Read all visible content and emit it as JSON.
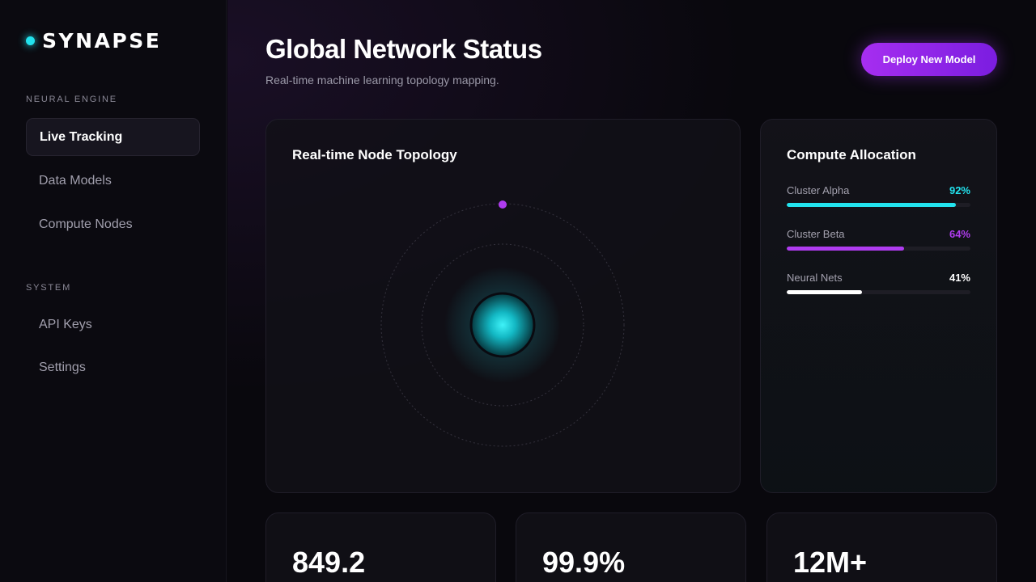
{
  "brand": {
    "name": "SYNAPSE",
    "accent": "#22e3ee"
  },
  "sidebar": {
    "sections": [
      {
        "label": "NEURAL ENGINE",
        "items": [
          "Live Tracking",
          "Data Models",
          "Compute Nodes"
        ]
      },
      {
        "label": "SYSTEM",
        "items": [
          "API Keys",
          "Settings"
        ]
      }
    ],
    "active_item": "Live Tracking"
  },
  "header": {
    "title": "Global Network Status",
    "subtitle": "Real-time machine learning topology mapping.",
    "deploy_label": "Deploy New Model"
  },
  "topology": {
    "title": "Real-time Node Topology"
  },
  "allocation": {
    "title": "Compute Allocation",
    "items": [
      {
        "name": "Cluster Alpha",
        "percent_label": "92%",
        "fraction": 0.92,
        "color": "#22e3ee"
      },
      {
        "name": "Cluster Beta",
        "percent_label": "64%",
        "fraction": 0.64,
        "color": "#b03cf0"
      },
      {
        "name": "Neural Nets",
        "percent_label": "41%",
        "fraction": 0.41,
        "color": "#ffffff"
      }
    ]
  },
  "stats": [
    {
      "value": "849.2"
    },
    {
      "value": "99.9%"
    },
    {
      "value": "12M+"
    }
  ],
  "colors": {
    "accent_cyan": "#22e3ee",
    "accent_purple": "#a62ef0",
    "background": "#09080d"
  }
}
